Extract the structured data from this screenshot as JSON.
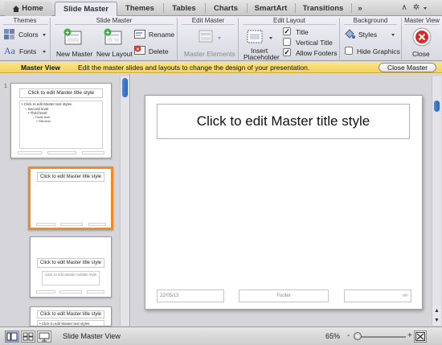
{
  "tabs": {
    "home": "Home",
    "slide_master": "Slide Master",
    "themes": "Themes",
    "tables": "Tables",
    "charts": "Charts",
    "smartart": "SmartArt",
    "transitions": "Transitions",
    "more": "»"
  },
  "ribbon": {
    "groups": {
      "themes": "Themes",
      "slide_master": "Slide Master",
      "edit_master": "Edit Master",
      "edit_layout": "Edit Layout",
      "background": "Background",
      "master_view": "Master View"
    },
    "colors": "Colors",
    "fonts": "Fonts",
    "fonts_glyph": "Aa",
    "new_master": "New Master",
    "new_layout": "New Layout",
    "rename": "Rename",
    "delete": "Delete",
    "master_elements": "Master Elements",
    "insert_placeholder_1": "Insert",
    "insert_placeholder_2": "Placeholder",
    "title_check": "Title",
    "vertical_title_check": "Vertical Title",
    "allow_footers_check": "Allow Footers",
    "styles": "Styles",
    "hide_graphics": "Hide Graphics",
    "close": "Close"
  },
  "infobar": {
    "label": "Master View",
    "message": "Edit the master slides and layouts to change the design of your presentation.",
    "close_button": "Close Master"
  },
  "thumbnails": {
    "master": {
      "number": "1",
      "title": "Click to edit Master title style",
      "body_lines": [
        "• Click to edit Master text styles",
        "– Second level",
        "• Third level",
        "– Fourth level",
        "» Fifth level"
      ]
    },
    "layout1": {
      "title": "Click to edit Master title style"
    },
    "layout2": {
      "title": "Click to edit Master title style",
      "subtitle": "Click to edit Master subtitle style"
    },
    "layout3": {
      "title": "Click to edit Master title style",
      "body": "• Click to edit Master text styles"
    }
  },
  "slide": {
    "title": "Click to edit Master title style",
    "date": "22/05/13",
    "footer": "Footer",
    "number": "‹#›"
  },
  "status": {
    "view_name": "Slide Master View",
    "zoom": "65%"
  },
  "colors": {
    "accent_orange": "#f08a24",
    "infobar_yellow": "#f8dc72",
    "scroll_blue": "#3a6fc4"
  }
}
